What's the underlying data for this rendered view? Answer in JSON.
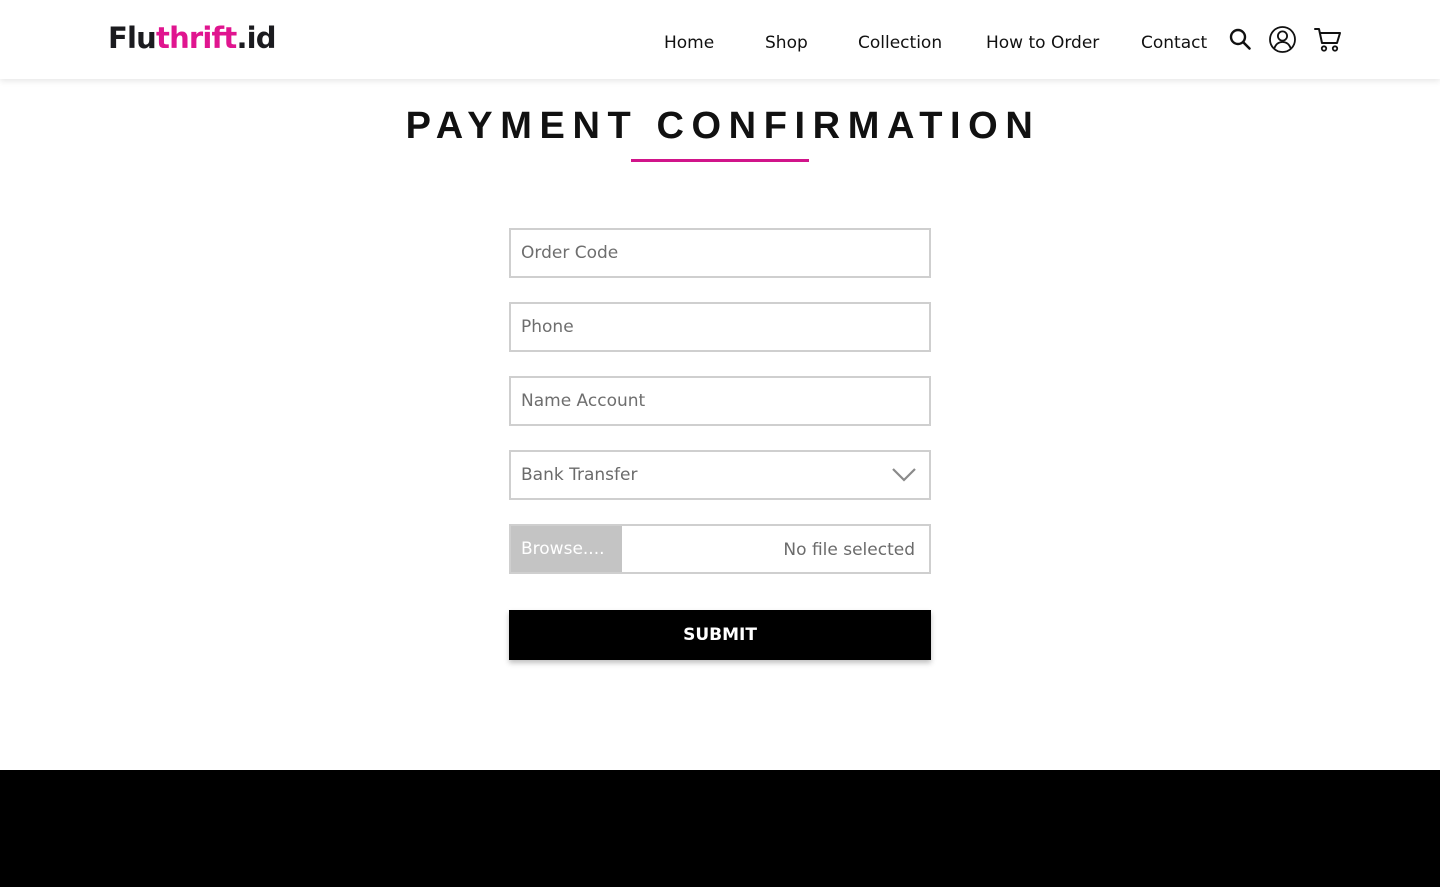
{
  "brand": {
    "part1": "Flu",
    "part2": "thrift",
    "part3": ".id",
    "colors": {
      "dark": "#1b1b1f",
      "accent": "#e0158f"
    }
  },
  "nav": {
    "items": [
      {
        "label": "Home"
      },
      {
        "label": "Shop"
      },
      {
        "label": "Collection"
      },
      {
        "label": "How to Order"
      },
      {
        "label": "Contact"
      }
    ],
    "icons": [
      "search-icon",
      "user-account-icon",
      "shopping-cart-icon"
    ]
  },
  "page": {
    "title": "PAYMENT CONFIRMATION",
    "accent_color": "#d1148a"
  },
  "form": {
    "order_code": {
      "placeholder": "Order Code",
      "value": ""
    },
    "phone": {
      "placeholder": "Phone",
      "value": ""
    },
    "name_account": {
      "placeholder": "Name Account",
      "value": ""
    },
    "payment_method": {
      "selected": "Bank Transfer"
    },
    "file": {
      "browse_label": "Browse....",
      "status": "No file selected"
    },
    "submit_label": "SUBMIT"
  },
  "footer": {
    "background": "#000000"
  }
}
